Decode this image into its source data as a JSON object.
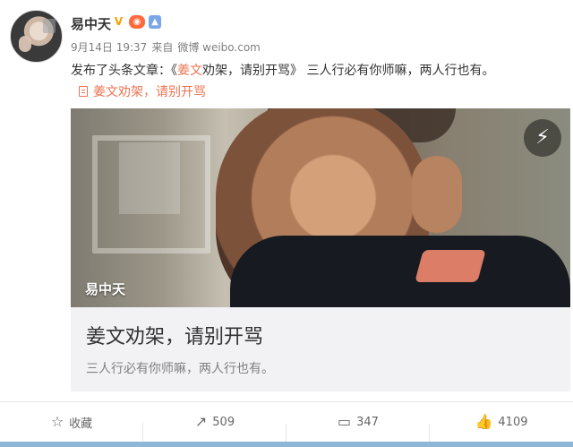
{
  "user": {
    "name": "易中天",
    "time": "9月14日 19:37",
    "source_prefix": "来自",
    "source": "微博 weibo.com"
  },
  "post": {
    "text_prefix": "发布了头条文章：",
    "article_open": "《",
    "article_highlight": "姜文",
    "article_rest": "劝架，请别开骂》",
    "text_suffix": "三人行必有你师嘛，两人行也有。",
    "link_text": "姜文劝架，请别开骂"
  },
  "card": {
    "photo_caption": "易中天",
    "title": "姜文劝架，请别开骂",
    "subtitle": "三人行必有你师嘛，两人行也有。"
  },
  "actions": {
    "favorite_label": "收藏",
    "repost_count": "509",
    "comment_count": "347",
    "like_count": "4109"
  }
}
